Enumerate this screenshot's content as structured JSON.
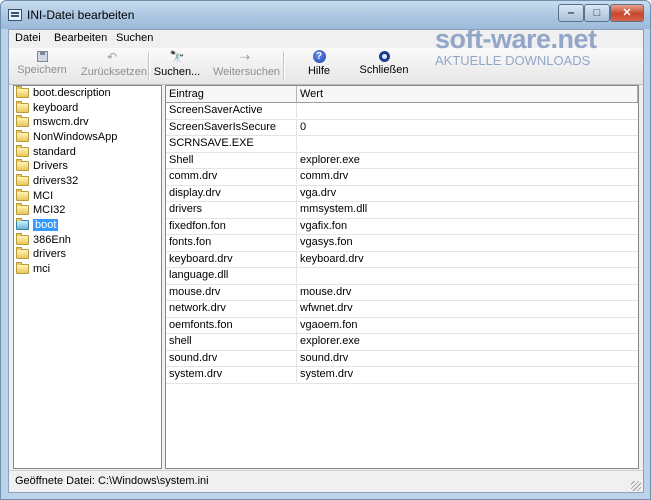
{
  "window": {
    "title": "INI-Datei bearbeiten",
    "controls": {
      "minimize": "‒",
      "maximize": "□",
      "close": "✕"
    }
  },
  "menu": [
    "Datei",
    "Bearbeiten",
    "Suchen"
  ],
  "toolbar": {
    "save": "Speichern",
    "reset": "Zurücksetzen",
    "search": "Suchen...",
    "search_next": "Weitersuchen",
    "help": "Hilfe",
    "close": "Schließen",
    "reset_icon": "↶",
    "search_icon": "🔭",
    "search_next_icon": "⇢",
    "help_icon": "?"
  },
  "tree": {
    "items": [
      "boot.description",
      "keyboard",
      "mswcm.drv",
      "NonWindowsApp",
      "standard",
      "Drivers",
      "drivers32",
      "MCI",
      "MCI32",
      "boot",
      "386Enh",
      "drivers",
      "mci"
    ],
    "selected": "boot"
  },
  "grid": {
    "headers": {
      "key": "Eintrag",
      "value": "Wert"
    },
    "rows": [
      {
        "key": "ScreenSaverActive",
        "value": ""
      },
      {
        "key": "ScreenSaverIsSecure",
        "value": "0"
      },
      {
        "key": "SCRNSAVE.EXE",
        "value": ""
      },
      {
        "key": "Shell",
        "value": "explorer.exe"
      },
      {
        "key": "comm.drv",
        "value": "comm.drv"
      },
      {
        "key": "display.drv",
        "value": "vga.drv"
      },
      {
        "key": "drivers",
        "value": "mmsystem.dll"
      },
      {
        "key": "fixedfon.fon",
        "value": "vgafix.fon"
      },
      {
        "key": "fonts.fon",
        "value": "vgasys.fon"
      },
      {
        "key": "keyboard.drv",
        "value": "keyboard.drv"
      },
      {
        "key": "language.dll",
        "value": ""
      },
      {
        "key": "mouse.drv",
        "value": "mouse.drv"
      },
      {
        "key": "network.drv",
        "value": "wfwnet.drv"
      },
      {
        "key": "oemfonts.fon",
        "value": "vgaoem.fon"
      },
      {
        "key": "shell",
        "value": "explorer.exe"
      },
      {
        "key": "sound.drv",
        "value": "sound.drv"
      },
      {
        "key": "system.drv",
        "value": "system.drv"
      }
    ]
  },
  "status": {
    "text": "Geöffnete Datei: C:\\Windows\\system.ini"
  },
  "watermark": {
    "brand": "soft-ware.net",
    "tagline": "AKTUELLE DOWNLOADS"
  }
}
